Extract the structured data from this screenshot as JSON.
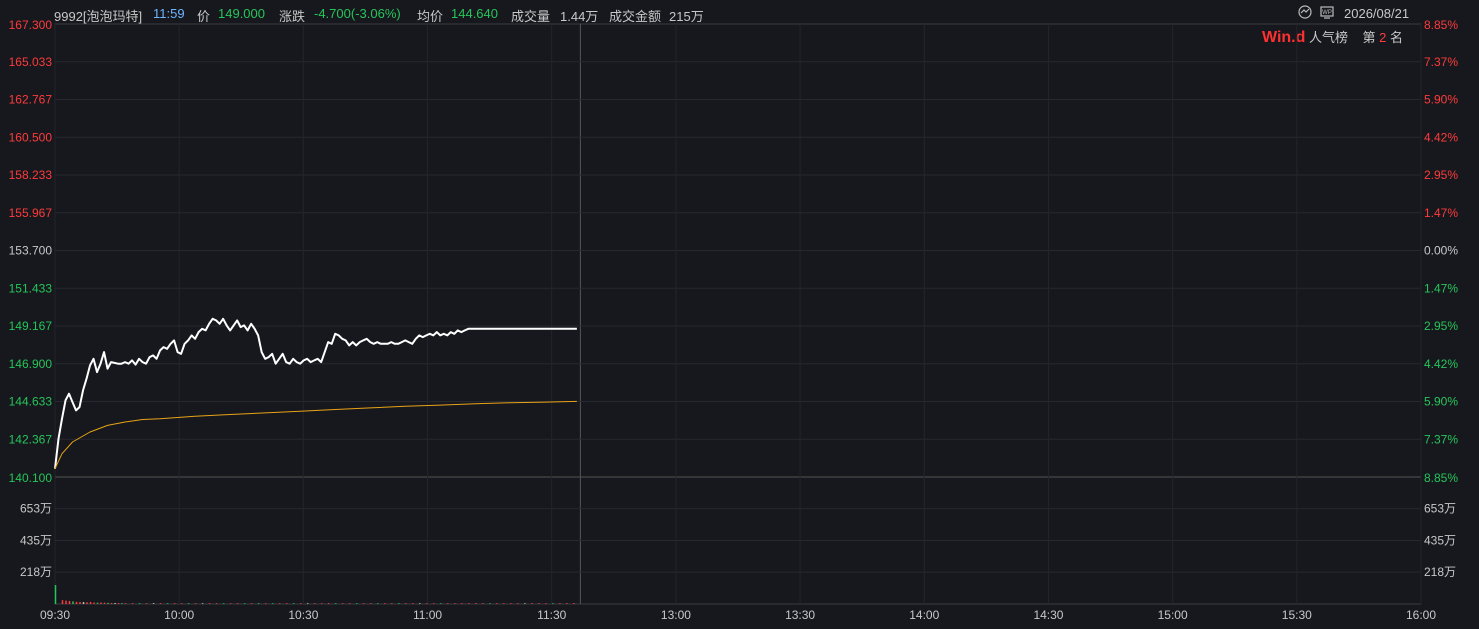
{
  "header": {
    "code_name": "9992[泡泡玛特]",
    "time": "11:59",
    "price_label": "价",
    "price": "149.000",
    "change_label": "涨跌",
    "change": "-4.700(-3.06%)",
    "avg_label": "均价",
    "avg": "144.640",
    "volume_label": "成交量",
    "volume": "1.44万",
    "amount_label": "成交金额",
    "amount": "215万",
    "date": "2026/08/21",
    "icons": [
      "chart-toggle-icon",
      "wp-icon"
    ]
  },
  "popularity": {
    "logo": "Win.d",
    "label": "人气榜",
    "rank_prefix": "第",
    "rank": "2",
    "rank_suffix": "名"
  },
  "colors": {
    "price_line": "#ffffff",
    "avg_line": "#e8a317",
    "up": "#ff3b3b",
    "down": "#26c55a",
    "neutral": "#c8c8c8"
  },
  "chart_data": {
    "type": "line",
    "prev_close": 153.7,
    "ylim": [
      140.1,
      167.3
    ],
    "price_ticks": [
      "167.300",
      "165.033",
      "162.767",
      "160.500",
      "158.233",
      "155.967",
      "153.700",
      "151.433",
      "149.167",
      "146.900",
      "144.633",
      "142.367",
      "140.100"
    ],
    "pct_ticks": [
      "8.85%",
      "7.37%",
      "5.90%",
      "4.42%",
      "2.95%",
      "1.47%",
      "0.00%",
      "1.47%",
      "2.95%",
      "4.42%",
      "5.90%",
      "7.37%",
      "8.85%"
    ],
    "volume_ticks": [
      "653万",
      "435万",
      "218万"
    ],
    "x_ticks": [
      "09:30",
      "10:00",
      "10:30",
      "11:00",
      "11:30",
      "13:00",
      "13:30",
      "14:00",
      "14:30",
      "15:00",
      "15:30",
      "16:00"
    ],
    "series": [
      {
        "name": "价",
        "x_minutes": [
          0,
          1,
          2,
          3,
          4,
          5,
          6,
          7,
          8,
          9,
          10,
          11,
          12,
          13,
          14,
          15,
          16,
          17,
          18,
          19,
          20,
          21,
          22,
          23,
          24,
          25,
          26,
          27,
          28,
          29,
          30,
          31,
          32,
          33,
          34,
          35,
          36,
          37,
          38,
          39,
          40,
          41,
          42,
          43,
          44,
          45,
          46,
          47,
          48,
          49,
          50,
          51,
          52,
          53,
          54,
          55,
          56,
          57,
          58,
          59,
          60,
          61,
          62,
          63,
          64,
          65,
          66,
          67,
          68,
          69,
          70,
          71,
          72,
          73,
          74,
          75,
          76,
          77,
          78,
          79,
          80,
          81,
          82,
          83,
          84,
          85,
          86,
          87,
          88,
          89,
          90,
          91,
          92,
          93,
          94,
          95,
          96,
          97,
          98,
          99,
          100,
          101,
          102,
          103,
          104,
          105,
          106,
          107,
          108,
          109,
          110,
          111,
          112,
          113,
          114,
          115,
          116,
          117,
          118,
          119,
          120,
          121,
          122,
          123,
          124,
          125,
          126,
          127,
          128,
          129,
          130,
          131,
          132,
          133,
          134,
          135,
          136,
          137,
          138,
          139,
          140,
          141,
          142,
          143,
          144,
          145,
          146,
          147,
          148,
          149
        ],
        "values": [
          140.6,
          142.4,
          143.6,
          144.7,
          145.1,
          144.6,
          144.1,
          144.3,
          145.3,
          146.0,
          146.8,
          147.2,
          146.4,
          146.9,
          147.6,
          146.6,
          147.0,
          146.95,
          146.9,
          146.9,
          147.0,
          146.9,
          147.1,
          146.85,
          147.2,
          147.0,
          146.9,
          147.3,
          147.4,
          147.2,
          147.7,
          147.9,
          147.8,
          148.1,
          148.3,
          147.6,
          147.5,
          148.1,
          148.3,
          148.6,
          148.4,
          148.8,
          149.0,
          148.9,
          149.3,
          149.6,
          149.5,
          149.3,
          149.6,
          149.2,
          148.9,
          149.2,
          149.5,
          149.1,
          149.2,
          148.9,
          149.3,
          149.0,
          148.6,
          147.6,
          147.2,
          147.3,
          147.5,
          146.9,
          147.2,
          147.5,
          147.0,
          146.9,
          147.2,
          147.0,
          146.9,
          147.1,
          147.2,
          147.0,
          147.1,
          147.2,
          147.0,
          147.6,
          148.2,
          148.1,
          148.7,
          148.6,
          148.4,
          148.3,
          148.0,
          148.2,
          148.0,
          148.2,
          148.3,
          148.4,
          148.2,
          148.1,
          148.2,
          148.1,
          148.1,
          148.1,
          148.2,
          148.1,
          148.1,
          148.2,
          148.3,
          148.2,
          148.1,
          148.4,
          148.6,
          148.5,
          148.6,
          148.7,
          148.6,
          148.8,
          148.6,
          148.7,
          148.6,
          148.8,
          148.7,
          148.9,
          148.8,
          148.9,
          149.0,
          149.0,
          149.0,
          149.0,
          149.0,
          149.0,
          149.0,
          149.0,
          149.0,
          149.0,
          149.0,
          149.0,
          149.0,
          149.0,
          149.0,
          149.0,
          149.0,
          149.0,
          149.0,
          149.0,
          149.0,
          149.0,
          149.0,
          149.0,
          149.0,
          149.0,
          149.0,
          149.0,
          149.0,
          149.0,
          149.0,
          149.0
        ]
      },
      {
        "name": "均价",
        "x_minutes": [
          0,
          2,
          5,
          10,
          15,
          20,
          25,
          30,
          40,
          50,
          60,
          70,
          80,
          90,
          100,
          110,
          120,
          130,
          140,
          149
        ],
        "values": [
          140.6,
          141.5,
          142.2,
          142.8,
          143.2,
          143.4,
          143.55,
          143.6,
          143.75,
          143.85,
          143.95,
          144.05,
          144.15,
          144.25,
          144.35,
          144.42,
          144.5,
          144.56,
          144.6,
          144.64
        ]
      }
    ],
    "volume_bars": [
      {
        "x": 0,
        "v": 12.6,
        "c": "down"
      },
      {
        "x": 2,
        "v": 2.2,
        "c": "up"
      },
      {
        "x": 3,
        "v": 1.9,
        "c": "up"
      },
      {
        "x": 4,
        "v": 1.7,
        "c": "up"
      },
      {
        "x": 5,
        "v": 1.4,
        "c": "down"
      },
      {
        "x": 6,
        "v": 1.1,
        "c": "up"
      },
      {
        "x": 7,
        "v": 1.0,
        "c": "up"
      },
      {
        "x": 8,
        "v": 0.9,
        "c": "neutral"
      },
      {
        "x": 9,
        "v": 0.8,
        "c": "up"
      },
      {
        "x": 10,
        "v": 1.0,
        "c": "up"
      },
      {
        "x": 11,
        "v": 0.6,
        "c": "up"
      },
      {
        "x": 12,
        "v": 0.5,
        "c": "down"
      },
      {
        "x": 13,
        "v": 0.6,
        "c": "up"
      },
      {
        "x": 14,
        "v": 0.5,
        "c": "up"
      },
      {
        "x": 15,
        "v": 0.4,
        "c": "down"
      },
      {
        "x": 16,
        "v": 0.3,
        "c": "up"
      },
      {
        "x": 17,
        "v": 0.25,
        "c": "neutral"
      },
      {
        "x": 18,
        "v": 0.2,
        "c": "up"
      },
      {
        "x": 19,
        "v": 0.2,
        "c": "down"
      },
      {
        "x": 20,
        "v": 0.15,
        "c": "up"
      },
      {
        "x": 22,
        "v": 0.15,
        "c": "up"
      },
      {
        "x": 24,
        "v": 0.15,
        "c": "down"
      },
      {
        "x": 26,
        "v": 0.1,
        "c": "up"
      },
      {
        "x": 28,
        "v": 0.15,
        "c": "neutral"
      },
      {
        "x": 30,
        "v": 0.15,
        "c": "up"
      },
      {
        "x": 32,
        "v": 0.1,
        "c": "down"
      },
      {
        "x": 34,
        "v": 0.15,
        "c": "up"
      },
      {
        "x": 36,
        "v": 0.1,
        "c": "up"
      },
      {
        "x": 38,
        "v": 0.1,
        "c": "down"
      },
      {
        "x": 40,
        "v": 0.15,
        "c": "up"
      },
      {
        "x": 42,
        "v": 0.1,
        "c": "neutral"
      },
      {
        "x": 44,
        "v": 0.15,
        "c": "up"
      },
      {
        "x": 46,
        "v": 0.1,
        "c": "up"
      },
      {
        "x": 48,
        "v": 0.1,
        "c": "down"
      },
      {
        "x": 50,
        "v": 0.1,
        "c": "up"
      },
      {
        "x": 52,
        "v": 0.1,
        "c": "up"
      },
      {
        "x": 54,
        "v": 0.1,
        "c": "down"
      },
      {
        "x": 56,
        "v": 0.1,
        "c": "up"
      },
      {
        "x": 58,
        "v": 0.15,
        "c": "down"
      },
      {
        "x": 60,
        "v": 0.1,
        "c": "up"
      },
      {
        "x": 62,
        "v": 0.1,
        "c": "down"
      },
      {
        "x": 64,
        "v": 0.1,
        "c": "up"
      },
      {
        "x": 66,
        "v": 0.1,
        "c": "up"
      },
      {
        "x": 68,
        "v": 0.1,
        "c": "down"
      },
      {
        "x": 70,
        "v": 0.1,
        "c": "up"
      },
      {
        "x": 72,
        "v": 0.1,
        "c": "neutral"
      },
      {
        "x": 74,
        "v": 0.1,
        "c": "up"
      },
      {
        "x": 76,
        "v": 0.1,
        "c": "up"
      },
      {
        "x": 78,
        "v": 0.15,
        "c": "up"
      },
      {
        "x": 80,
        "v": 0.1,
        "c": "down"
      },
      {
        "x": 82,
        "v": 0.1,
        "c": "up"
      },
      {
        "x": 84,
        "v": 0.1,
        "c": "up"
      },
      {
        "x": 86,
        "v": 0.1,
        "c": "down"
      },
      {
        "x": 88,
        "v": 0.1,
        "c": "up"
      },
      {
        "x": 90,
        "v": 0.1,
        "c": "up"
      },
      {
        "x": 92,
        "v": 0.1,
        "c": "down"
      },
      {
        "x": 94,
        "v": 0.1,
        "c": "up"
      },
      {
        "x": 96,
        "v": 0.1,
        "c": "up"
      },
      {
        "x": 98,
        "v": 0.1,
        "c": "down"
      },
      {
        "x": 100,
        "v": 0.1,
        "c": "up"
      },
      {
        "x": 102,
        "v": 0.1,
        "c": "up"
      },
      {
        "x": 104,
        "v": 0.1,
        "c": "neutral"
      },
      {
        "x": 106,
        "v": 0.1,
        "c": "up"
      },
      {
        "x": 108,
        "v": 0.1,
        "c": "up"
      },
      {
        "x": 110,
        "v": 0.1,
        "c": "down"
      },
      {
        "x": 112,
        "v": 0.1,
        "c": "up"
      },
      {
        "x": 114,
        "v": 0.1,
        "c": "up"
      },
      {
        "x": 116,
        "v": 0.1,
        "c": "up"
      },
      {
        "x": 118,
        "v": 0.1,
        "c": "up"
      },
      {
        "x": 120,
        "v": 0.15,
        "c": "up"
      },
      {
        "x": 122,
        "v": 0.1,
        "c": "up"
      },
      {
        "x": 124,
        "v": 0.1,
        "c": "down"
      },
      {
        "x": 126,
        "v": 0.1,
        "c": "up"
      },
      {
        "x": 128,
        "v": 0.1,
        "c": "up"
      },
      {
        "x": 130,
        "v": 0.1,
        "c": "up"
      },
      {
        "x": 132,
        "v": 0.1,
        "c": "up"
      },
      {
        "x": 134,
        "v": 0.1,
        "c": "neutral"
      },
      {
        "x": 136,
        "v": 0.15,
        "c": "up"
      },
      {
        "x": 138,
        "v": 0.1,
        "c": "up"
      },
      {
        "x": 140,
        "v": 0.1,
        "c": "up"
      },
      {
        "x": 142,
        "v": 0.1,
        "c": "down"
      },
      {
        "x": 144,
        "v": 0.15,
        "c": "up"
      },
      {
        "x": 146,
        "v": 0.15,
        "c": "up"
      },
      {
        "x": 148,
        "v": 0.2,
        "c": "up"
      }
    ],
    "volume_max": 870,
    "grid": true
  }
}
